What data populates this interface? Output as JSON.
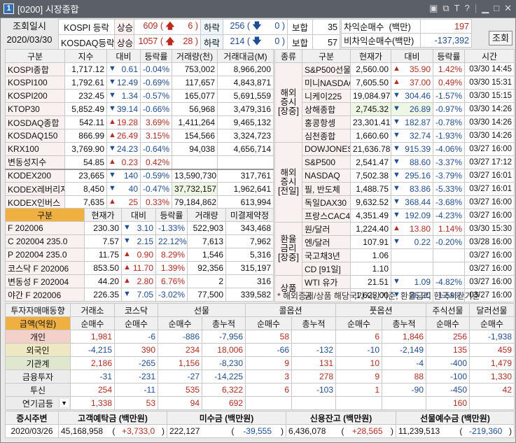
{
  "window": {
    "number": "1",
    "title": "[0200] 시장종합",
    "icons": [
      "layout-icon",
      "link-icon",
      "text-icon",
      "help-icon",
      "minimize-icon",
      "maximize-icon",
      "close-icon"
    ]
  },
  "top": {
    "query_label": "조회일시",
    "query_date": "2020/03/30",
    "rows": [
      {
        "name": "KOSPI 등락",
        "up_label": "상승",
        "up": "609",
        "up_limit": "6",
        "down_label": "하락",
        "down": "256",
        "down_limit": "0",
        "flat_label": "보합",
        "flat": "35"
      },
      {
        "name": "KOSDAQ등락",
        "up_label": "상승",
        "up": "1057",
        "up_limit": "28",
        "down_label": "하락",
        "down": "214",
        "down_limit": "0",
        "flat_label": "보합",
        "flat": "57"
      }
    ],
    "arb": [
      {
        "label": "차익순매수  (백만)",
        "value": "197"
      },
      {
        "label": "비차익순매수(백만)",
        "value": "-137,392"
      }
    ],
    "query_button": "조회"
  },
  "index_table": {
    "headers": [
      "구분",
      "지수",
      "대비",
      "등락률",
      "거래량(천)",
      "거래대금(M)"
    ],
    "rows": [
      [
        "KOSPI종합",
        "1,717.12",
        "down",
        "0.61",
        "-0.04%",
        "753,002",
        "8,966,200"
      ],
      [
        "KOSPI100",
        "1,792.61",
        "down",
        "12.49",
        "-0.69%",
        "117,657",
        "4,843,871"
      ],
      [
        "KOSPI200",
        "232.45",
        "down",
        "1.34",
        "-0.57%",
        "165,077",
        "5,691,559"
      ],
      [
        "KTOP30",
        "5,852.49",
        "down",
        "39.14",
        "-0.66%",
        "56,968",
        "3,479,316"
      ],
      [
        "KOSDAQ종합",
        "542.11",
        "up",
        "19.28",
        "3.69%",
        "1,411,264",
        "9,465,132"
      ],
      [
        "KOSDAQ150",
        "866.99",
        "up",
        "26.49",
        "3.15%",
        "154,566",
        "3,324,723"
      ],
      [
        "KRX100",
        "3,769.90",
        "down",
        "24.23",
        "-0.64%",
        "94,038",
        "4,656,714"
      ],
      [
        "변동성지수",
        "54.85",
        "up",
        "0.23",
        "0.42%",
        "",
        ""
      ],
      [
        "KODEX200",
        "23,665",
        "down",
        "140",
        "-0.59%",
        "13,590,730",
        "317,761"
      ],
      [
        "KODEX레버리지",
        "8,450",
        "down",
        "40",
        "-0.47%",
        "37,732,157",
        "1,962,641"
      ],
      [
        "KODEX인버스",
        "7,635",
        "up",
        "25",
        "0.33%",
        "79,184,862",
        "613,994"
      ]
    ]
  },
  "futures_table": {
    "headers": [
      "구분",
      "현재가",
      "대비",
      "등락률",
      "거래량",
      "미결제약정"
    ],
    "rows": [
      [
        "F 202006",
        "230.30",
        "down",
        "3.10",
        "-1.33%",
        "522,903",
        "343,468"
      ],
      [
        "C 202004 235.0",
        "7.57",
        "down",
        "2.15",
        "22.12%",
        "7,613",
        "7,962"
      ],
      [
        "P 202004 235.0",
        "11.75",
        "up",
        "0.90",
        "8.29%",
        "1,546",
        "5,316"
      ],
      [
        "코스닥 F 202006",
        "853.50",
        "up",
        "11.70",
        "1.39%",
        "92,356",
        "315,197"
      ],
      [
        "변동성 F 202004",
        "44.20",
        "up",
        "2.80",
        "6.76%",
        "2",
        "316"
      ],
      [
        "야간 F 202006",
        "226.35",
        "down",
        "7.05",
        "-3.02%",
        "77,500",
        "339,582"
      ]
    ]
  },
  "world_table": {
    "headers": [
      "종류",
      "구분",
      "현재가",
      "대비",
      "등락률",
      "시간"
    ],
    "groups": [
      {
        "label": "해외\n증시\n[장중]",
        "rows": [
          [
            "S&P500선물",
            "2,560.00",
            "up",
            "35.90",
            "1.42%",
            "03/30 14:45"
          ],
          [
            "미니NASDAQ",
            "7,605.50",
            "up",
            "37.00",
            "0.49%",
            "03/30 15:31"
          ],
          [
            "니케이225",
            "19,084.97",
            "down",
            "304.46",
            "-1.57%",
            "03/30 15:15"
          ],
          [
            "상해종합",
            "2,745.32",
            "down",
            "26.89",
            "-0.97%",
            "03/30 14:26"
          ],
          [
            "홍콩항셍",
            "23,301.41",
            "down",
            "182.87",
            "-0.78%",
            "03/30 14:26"
          ],
          [
            "심천종합",
            "1,660.60",
            "down",
            "32.74",
            "-1.93%",
            "03/30 14:26"
          ]
        ]
      },
      {
        "label": "해외\n증시\n[전일]",
        "rows": [
          [
            "DOWJONES",
            "21,636.78",
            "down",
            "915.39",
            "-4.06%",
            "03/27 16:00"
          ],
          [
            "S&P500",
            "2,541.47",
            "down",
            "88.60",
            "-3.37%",
            "03/27 17:12"
          ],
          [
            "NASDAQ",
            "7,502.38",
            "down",
            "295.16",
            "-3.79%",
            "03/27 16:01"
          ],
          [
            "필, 반도체",
            "1,488.75",
            "down",
            "83.86",
            "-5.33%",
            "03/27 16:01"
          ],
          [
            "독일DAX30",
            "9,632.52",
            "down",
            "368.44",
            "-3.68%",
            "03/27 16:00"
          ],
          [
            "프랑스CAC40",
            "4,351.49",
            "down",
            "192.09",
            "-4.23%",
            "03/27 16:00"
          ]
        ]
      },
      {
        "label": "환율\n금리\n[장중]",
        "rows": [
          [
            "원/달러",
            "1,224.40",
            "up",
            "13.80",
            "1.14%",
            "03/30 15:30"
          ],
          [
            "엔/달러",
            "107.91",
            "down",
            "0.22",
            "-0.20%",
            "03/28 16:00"
          ],
          [
            "국고채3년",
            "1.06",
            "",
            "",
            "",
            "03/27 16:00"
          ],
          [
            "CD [91일]",
            "1.10",
            "",
            "",
            "",
            "03/27 16:00"
          ]
        ]
      },
      {
        "label": "상품",
        "rows": [
          [
            "WTI 유가",
            "21.51",
            "down",
            "1.09",
            "-4.82%",
            "03/27 16:00"
          ],
          [
            "금",
            "1,625.00",
            "down",
            "26.20",
            "-1.59%",
            "03/27 16:00"
          ]
        ]
      }
    ],
    "note": "* 해외증시/상품 해당국가시간기준, 환율금리 한국시간기준"
  },
  "investor_table": {
    "title": "투자자매매동향",
    "groups": [
      "거래소",
      "코스닥",
      "선물",
      "콜옵션",
      "풋옵션",
      "주식선물",
      "달러선물"
    ],
    "unit_label": "금액(억원)",
    "subheaders": [
      "순매수",
      "순매수",
      "순매수",
      "총누적",
      "순매수",
      "총누적",
      "순매수",
      "총누적",
      "순매수",
      "순매수"
    ],
    "rows": [
      {
        "label": "개인",
        "color": "#f4d0cb",
        "values": [
          "1,981",
          "-6",
          "-886",
          "-7,956",
          "58",
          "",
          "6",
          "1,846",
          "256",
          "-1,938"
        ]
      },
      {
        "label": "외국인",
        "color": "#ede7c2",
        "values": [
          "-4,215",
          "390",
          "234",
          "18,006",
          "-66",
          "-132",
          "-10",
          "-2,149",
          "135",
          "459"
        ]
      },
      {
        "label": "기관계",
        "color": "#dfe7cf",
        "values": [
          "2,186",
          "-265",
          "1,156",
          "-8,230",
          "9",
          "131",
          "10",
          "-4",
          "-400",
          "1,479"
        ]
      },
      {
        "label": "금융투자",
        "color": "#ececec",
        "values": [
          "-31",
          "-231",
          "-27",
          "-14,225",
          "3",
          "278",
          "9",
          "88",
          "-100",
          "1,330"
        ]
      },
      {
        "label": "투신",
        "color": "#ececec",
        "values": [
          "254",
          "-11",
          "535",
          "6,322",
          "6",
          "-103",
          "1",
          "-90",
          "-450",
          "42"
        ]
      },
      {
        "label": "연기금등",
        "color": "#ececec",
        "dropdown": true,
        "values": [
          "1,338",
          "53",
          "94",
          "692",
          "",
          "",
          "",
          "",
          "160",
          ""
        ]
      }
    ]
  },
  "market_table": {
    "headers": [
      "증시주변",
      "고객예탁금 (백만원)",
      "미수금 (백만원)",
      "신용잔고 (백만원)",
      "선물예수금 (백만원)"
    ],
    "date": "2020/03/26",
    "items": [
      {
        "value": "45,168,958",
        "change": "+3,733,0"
      },
      {
        "value": "222,127",
        "change": "-39,555"
      },
      {
        "value": "6,436,078",
        "change": "+28,565"
      },
      {
        "value": "11,239,513",
        "change": "-219,360"
      }
    ]
  },
  "colors": {
    "up": "#c0281c",
    "down": "#1d4c9a",
    "title_bar": "#5b6068",
    "orange_header": "#f0b040"
  }
}
